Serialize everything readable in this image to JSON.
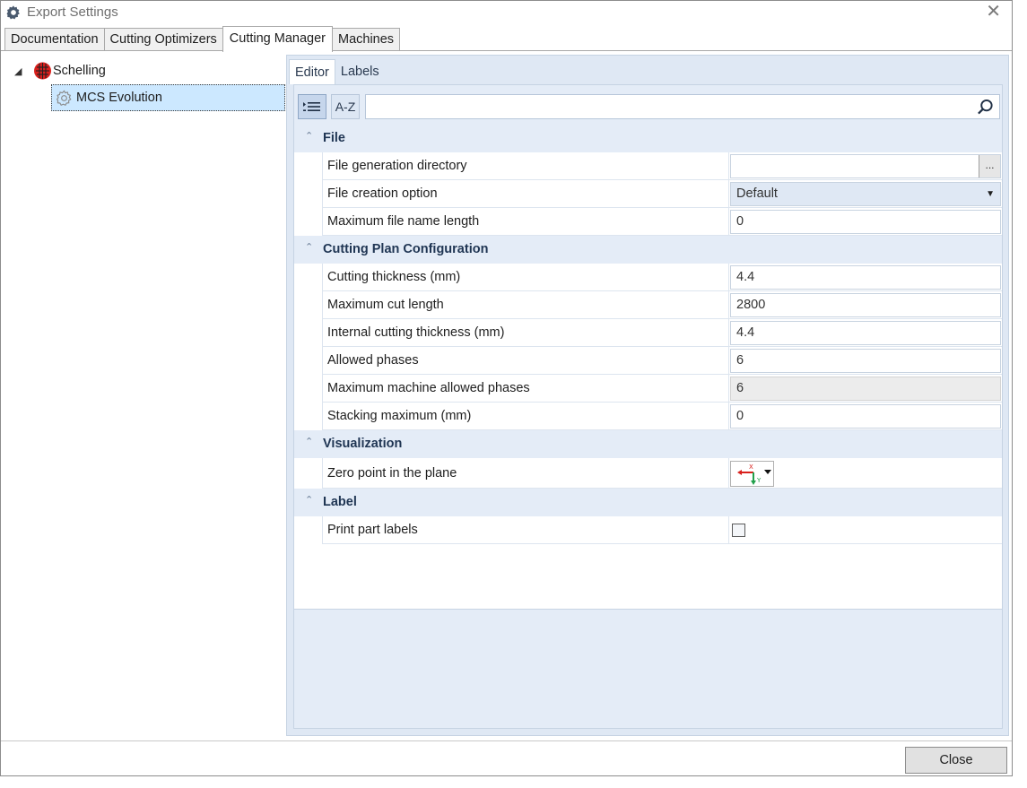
{
  "window": {
    "title": "Export Settings",
    "title_icon": "gear-icon",
    "close_glyph": "✕"
  },
  "main_tabs": [
    {
      "label": "Documentation"
    },
    {
      "label": "Cutting Optimizers"
    },
    {
      "label": "Cutting Manager",
      "active": true
    },
    {
      "label": "Machines"
    }
  ],
  "tree": {
    "root": {
      "label": "Schelling",
      "icon": "schelling-logo-icon",
      "expanded": true
    },
    "child": {
      "label": "MCS Evolution",
      "icon": "gear-icon",
      "selected": true
    }
  },
  "sub_tabs": [
    {
      "label": "Editor",
      "active": true
    },
    {
      "label": "Labels"
    }
  ],
  "toolbar": {
    "categorized_icon": "categorized-list-icon",
    "alphabetical_label": "A-Z",
    "search_value": "",
    "search_icon": "search-icon"
  },
  "categories": [
    {
      "label": "File",
      "rows": [
        {
          "name": "File generation directory",
          "value": "",
          "kind": "browse",
          "browse_label": "..."
        },
        {
          "name": "File creation option",
          "value": "Default",
          "kind": "dropdown"
        },
        {
          "name": "Maximum file name length",
          "value": "0",
          "kind": "text"
        }
      ]
    },
    {
      "label": "Cutting Plan Configuration",
      "rows": [
        {
          "name": "Cutting thickness (mm)",
          "value": "4.4",
          "kind": "text"
        },
        {
          "name": "Maximum cut length",
          "value": "2800",
          "kind": "text"
        },
        {
          "name": "Internal cutting thickness (mm)",
          "value": "4.4",
          "kind": "text"
        },
        {
          "name": "Allowed phases",
          "value": "6",
          "kind": "text"
        },
        {
          "name": "Maximum machine allowed phases",
          "value": "6",
          "kind": "readonly"
        },
        {
          "name": "Stacking maximum (mm)",
          "value": "0",
          "kind": "text"
        }
      ]
    },
    {
      "label": "Visualization",
      "rows": [
        {
          "name": "Zero point in the plane",
          "kind": "zero-point",
          "icon": "axis-origin-icon"
        }
      ]
    },
    {
      "label": "Label",
      "rows": [
        {
          "name": "Print part labels",
          "kind": "checkbox",
          "checked": false
        }
      ]
    }
  ],
  "footer": {
    "close_label": "Close"
  },
  "colors": {
    "accent": "#cce8ff",
    "category_bg": "#e4ecf7",
    "pane_bg": "#dfe8f4"
  }
}
